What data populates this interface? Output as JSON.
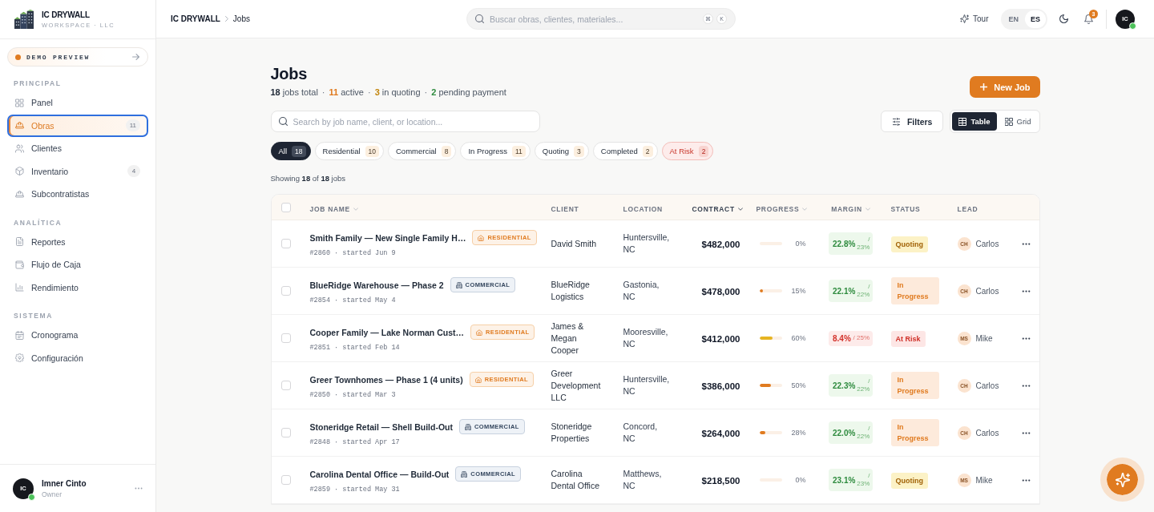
{
  "sidebar": {
    "brand": {
      "name": "IC DRYWALL",
      "subtitle": "WORKSPACE · LLC"
    },
    "demo": {
      "label": "DEMO PREVIEW"
    },
    "sections": [
      {
        "title": "PRINCIPAL",
        "items": [
          {
            "label": "Panel",
            "selected": false
          },
          {
            "label": "Obras",
            "selected": true,
            "count": "11"
          },
          {
            "label": "Clientes",
            "selected": false
          },
          {
            "label": "Inventario",
            "selected": false,
            "count": "4"
          },
          {
            "label": "Subcontratistas",
            "selected": false
          }
        ]
      },
      {
        "title": "ANALÍTICA",
        "items": [
          {
            "label": "Reportes",
            "selected": false
          },
          {
            "label": "Flujo de Caja",
            "selected": false
          },
          {
            "label": "Rendimiento",
            "selected": false
          }
        ]
      },
      {
        "title": "SISTEMA",
        "items": [
          {
            "label": "Cronograma",
            "selected": false
          },
          {
            "label": "Configuración",
            "selected": false
          }
        ]
      }
    ],
    "user": {
      "initials": "IC",
      "name": "Imner Cinto",
      "role": "Owner",
      "online": true
    }
  },
  "header": {
    "breadcrumb": [
      "IC DRYWALL",
      "Jobs"
    ],
    "search": {
      "placeholder": "Buscar obras, clientes, materiales...",
      "shortcut": [
        "⌘",
        "K"
      ]
    },
    "tour": "Tour",
    "languages": [
      {
        "code": "EN",
        "selected": false
      },
      {
        "code": "ES",
        "selected": true
      }
    ],
    "notifications": "3",
    "avatar": {
      "initials": "IC",
      "online": true
    }
  },
  "page": {
    "title": "Jobs",
    "summary": [
      {
        "number": "18",
        "text": "jobs total",
        "color": "#1f2937"
      },
      {
        "number": "11",
        "text": "active",
        "color": "#e07b20"
      },
      {
        "number": "3",
        "text": "in quoting",
        "color": "#c2850c"
      },
      {
        "number": "2",
        "text": "pending payment",
        "color": "#2e8b3e"
      }
    ],
    "separator": "·",
    "new_button": "New Job",
    "search": {
      "placeholder": "Search by job name, client, or location..."
    },
    "filters_button": "Filters",
    "views": [
      {
        "label": "Table",
        "selected": true
      },
      {
        "label": "Grid",
        "selected": false
      }
    ],
    "chips": [
      {
        "label": "All",
        "count": "18",
        "selected": true,
        "kind": "default"
      },
      {
        "label": "Residential",
        "count": "10",
        "selected": false,
        "kind": "default"
      },
      {
        "label": "Commercial",
        "count": "8",
        "selected": false,
        "kind": "default"
      },
      {
        "label": "In Progress",
        "count": "11",
        "selected": false,
        "kind": "default"
      },
      {
        "label": "Quoting",
        "count": "3",
        "selected": false,
        "kind": "default"
      },
      {
        "label": "Completed",
        "count": "2",
        "selected": false,
        "kind": "default"
      },
      {
        "label": "At Risk",
        "count": "2",
        "selected": false,
        "kind": "danger"
      }
    ],
    "showing": "Showing **18** of **18** jobs"
  },
  "table": {
    "select_all": {
      "checked": false
    },
    "columns": [
      {
        "label": "JOB NAME",
        "sortable": true,
        "sorted": false
      },
      {
        "label": "CLIENT",
        "sortable": false,
        "sorted": false
      },
      {
        "label": "LOCATION",
        "sortable": false,
        "sorted": false
      },
      {
        "label": "CONTRACT",
        "sortable": true,
        "sorted": true
      },
      {
        "label": "PROGRESS",
        "sortable": true,
        "sorted": false
      },
      {
        "label": "MARGIN",
        "sortable": true,
        "sorted": false
      },
      {
        "label": "STATUS",
        "sortable": false,
        "sorted": false
      },
      {
        "label": "LEAD",
        "sortable": false,
        "sorted": false
      }
    ],
    "rows": [
      {
        "checked": false,
        "name": "Smith Family — New Single Family H…",
        "type": {
          "label": "RESIDENTIAL",
          "kind": "residential"
        },
        "meta": "#2860 · started Jun 9",
        "client": "David Smith",
        "location": "Huntersville, NC",
        "contract": "$482,000",
        "progress": {
          "level": 0,
          "reading": "0%"
        },
        "margin": {
          "value": "22.8%",
          "target": "/ 23%",
          "alert": false
        },
        "status": {
          "label": "Quoting",
          "kind": "quoting"
        },
        "lead": {
          "initials": "CH",
          "name": "Carlos"
        }
      },
      {
        "checked": false,
        "name": "BlueRidge Warehouse — Phase 2",
        "type": {
          "label": "COMMERCIAL",
          "kind": "commercial"
        },
        "meta": "#2854 · started May 4",
        "client": "BlueRidge Logistics",
        "location": "Gastonia, NC",
        "contract": "$478,000",
        "progress": {
          "level": 0.15,
          "reading": "15%",
          "color": "#e07b20"
        },
        "margin": {
          "value": "22.1%",
          "target": "/ 22%",
          "alert": false
        },
        "status": {
          "label": "In Progress",
          "kind": "in_progress"
        },
        "lead": {
          "initials": "CH",
          "name": "Carlos"
        }
      },
      {
        "checked": false,
        "name": "Cooper Family — Lake Norman Cust…",
        "type": {
          "label": "RESIDENTIAL",
          "kind": "residential"
        },
        "meta": "#2851 · started Feb 14",
        "client": "James & Megan Cooper",
        "location": "Mooresville, NC",
        "contract": "$412,000",
        "progress": {
          "level": 0.6,
          "reading": "60%",
          "color": "#e6b422"
        },
        "margin": {
          "value": "8.4%",
          "target": "/ 25%",
          "alert": true
        },
        "status": {
          "label": "At Risk",
          "kind": "at_risk"
        },
        "lead": {
          "initials": "MS",
          "name": "Mike"
        }
      },
      {
        "checked": false,
        "name": "Greer Townhomes — Phase 1 (4 units)",
        "type": {
          "label": "RESIDENTIAL",
          "kind": "residential"
        },
        "meta": "#2850 · started Mar 3",
        "client": "Greer Development LLC",
        "location": "Huntersville, NC",
        "contract": "$386,000",
        "progress": {
          "level": 0.5,
          "reading": "50%",
          "color": "#e07b20"
        },
        "margin": {
          "value": "22.3%",
          "target": "/ 22%",
          "alert": false
        },
        "status": {
          "label": "In Progress",
          "kind": "in_progress"
        },
        "lead": {
          "initials": "CH",
          "name": "Carlos"
        }
      },
      {
        "checked": false,
        "name": "Stoneridge Retail — Shell Build-Out",
        "type": {
          "label": "COMMERCIAL",
          "kind": "commercial"
        },
        "meta": "#2848 · started Apr 17",
        "client": "Stoneridge Properties",
        "location": "Concord, NC",
        "contract": "$264,000",
        "progress": {
          "level": 0.28,
          "reading": "28%",
          "color": "#e07b20"
        },
        "margin": {
          "value": "22.0%",
          "target": "/ 22%",
          "alert": false
        },
        "status": {
          "label": "In Progress",
          "kind": "in_progress"
        },
        "lead": {
          "initials": "CH",
          "name": "Carlos"
        }
      },
      {
        "checked": false,
        "name": "Carolina Dental Office — Build-Out",
        "type": {
          "label": "COMMERCIAL",
          "kind": "commercial"
        },
        "meta": "#2859 · started May 31",
        "client": "Carolina Dental Office",
        "location": "Matthews, NC",
        "contract": "$218,500",
        "progress": {
          "level": 0,
          "reading": "0%"
        },
        "margin": {
          "value": "23.1%",
          "target": "/ 23%",
          "alert": false
        },
        "status": {
          "label": "Quoting",
          "kind": "quoting"
        },
        "lead": {
          "initials": "MS",
          "name": "Mike"
        }
      }
    ]
  }
}
